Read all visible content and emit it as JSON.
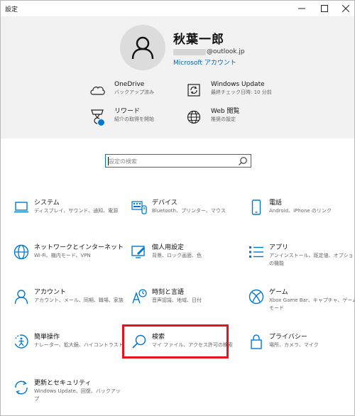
{
  "window": {
    "title": "設定"
  },
  "header": {
    "user_name": "秋葉一郎",
    "email_domain": "@outlook.jp",
    "account_link": "Microsoft アカウント",
    "quick": [
      {
        "title": "OneDrive",
        "sub": "バックアップ済み",
        "icon": "cloud-icon"
      },
      {
        "title": "Windows Update",
        "sub": "最終チェック日時: 10 分前",
        "icon": "update-icon"
      },
      {
        "title": "リワード",
        "sub": "紹介の取得を開始",
        "icon": "rewards-icon"
      },
      {
        "title": "Web 閲覧",
        "sub": "推奨の設定",
        "icon": "globe-icon"
      }
    ]
  },
  "search": {
    "placeholder": "設定の検索"
  },
  "tiles": [
    {
      "title": "システム",
      "sub": "ディスプレイ、サウンド、通知、電源",
      "icon": "laptop-icon"
    },
    {
      "title": "デバイス",
      "sub": "Bluetooth、プリンター、マウス",
      "icon": "keyboard-icon"
    },
    {
      "title": "電話",
      "sub": "Android、iPhone のリンク",
      "icon": "phone-icon"
    },
    {
      "title": "ネットワークとインターネット",
      "sub": "Wi-Fi、機内モード、VPN",
      "icon": "globe-icon"
    },
    {
      "title": "個人用設定",
      "sub": "背景、ロック画面、色",
      "icon": "personalization-icon"
    },
    {
      "title": "アプリ",
      "sub": "アンインストール、既定値、オプションの機能",
      "icon": "apps-icon"
    },
    {
      "title": "アカウント",
      "sub": "アカウント、メール、同期、職場、家族",
      "icon": "person-icon"
    },
    {
      "title": "時刻と言語",
      "sub": "音声認識、地域、日付",
      "icon": "time-language-icon"
    },
    {
      "title": "ゲーム",
      "sub": "Xbox Game Bar、キャプチャ、ゲーム モード",
      "icon": "xbox-icon"
    },
    {
      "title": "簡単操作",
      "sub": "ナレーター、拡大鏡、ハイコントラスト",
      "icon": "ease-of-access-icon"
    },
    {
      "title": "検索",
      "sub": "マイ ファイル、アクセス許可の検索",
      "icon": "search-icon"
    },
    {
      "title": "プライバシー",
      "sub": "場所、カメラ、マイク",
      "icon": "lock-icon"
    },
    {
      "title": "更新とセキュリティ",
      "sub": "Windows Update、回復、バックアップ",
      "icon": "sync-icon"
    }
  ],
  "colors": {
    "accent": "#0078d7",
    "highlight": "#e8121d",
    "header_bg": "#f2f2f2"
  }
}
